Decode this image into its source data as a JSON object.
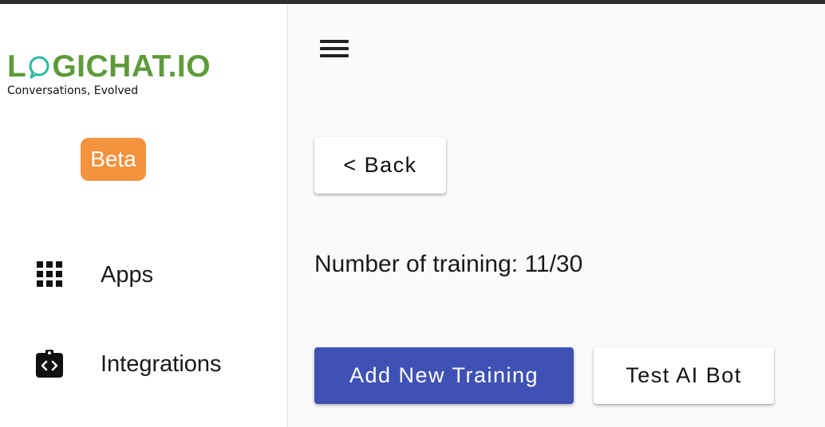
{
  "brand": {
    "logo_prefix": "L",
    "logo_suffix": "GICHAT.IO",
    "tagline": "Conversations, Evolved",
    "badge": "Beta",
    "colors": {
      "logo_green": "#5d9b3a",
      "bubble_teal": "#2bb8a0",
      "badge_orange": "#f5923e"
    }
  },
  "sidebar": {
    "items": [
      {
        "label": "Apps",
        "icon": "apps-grid-icon"
      },
      {
        "label": "Integrations",
        "icon": "integrations-code-icon"
      }
    ]
  },
  "header": {
    "menu_icon": "hamburger-menu-icon"
  },
  "main": {
    "back_label": "< Back",
    "training_count": "Number of training: 11/30",
    "add_training_label": "Add New Training",
    "test_bot_label": "Test AI Bot",
    "colors": {
      "primary": "#3f51b5"
    }
  }
}
